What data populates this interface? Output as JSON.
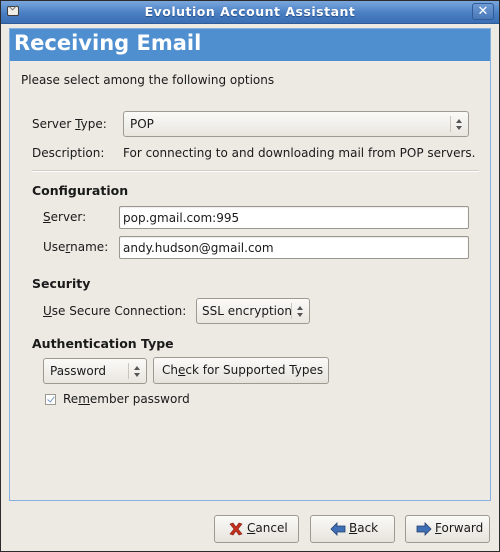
{
  "window": {
    "title": "Evolution Account Assistant",
    "icon": "mail-icon",
    "close_icon": "close-icon"
  },
  "page": {
    "heading": "Receiving Email",
    "intro": "Please select among the following options"
  },
  "server_type": {
    "label_pre": "Server ",
    "label_mnemonic": "T",
    "label_post": "ype:",
    "selected": "POP",
    "description_label": "Description:",
    "description": "For connecting to and downloading mail from POP servers."
  },
  "configuration": {
    "heading": "Configuration",
    "server_label_mnemonic": "S",
    "server_label_rest": "erver:",
    "server_value": "pop.gmail.com:995",
    "username_label_pre": "Use",
    "username_label_mnemonic": "r",
    "username_label_post": "name:",
    "username_value": "andy.hudson@gmail.com"
  },
  "security": {
    "heading": "Security",
    "secure_label_mnemonic": "U",
    "secure_label_rest": "se Secure Connection:",
    "secure_selected": "SSL encryption"
  },
  "authentication": {
    "heading": "Authentication Type",
    "type_selected": "Password",
    "check_button_pre": "Ch",
    "check_button_mnemonic": "e",
    "check_button_post": "ck for Supported Types",
    "remember_pre": "Re",
    "remember_mnemonic": "m",
    "remember_post": "ember password",
    "remember_checked": true
  },
  "buttons": {
    "cancel_mnemonic": "C",
    "cancel_rest": "ancel",
    "back_mnemonic": "B",
    "back_rest": "ack",
    "forward_mnemonic": "F",
    "forward_rest": "orward"
  },
  "colors": {
    "titlebar": "#4a7fc4",
    "header_band": "#4f8fd0",
    "background": "#edeae4",
    "cancel_icon": "#c8301e",
    "arrow_icon": "#3f6fb5"
  }
}
